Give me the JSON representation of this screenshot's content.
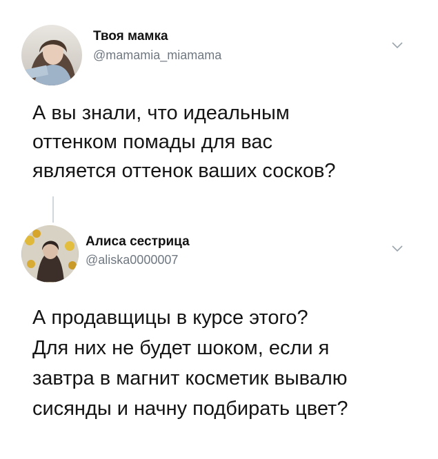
{
  "tweets": [
    {
      "author": {
        "display_name": "Твоя мамка",
        "handle": "@mamamia_miamama",
        "avatar_icon": "user-avatar-photo"
      },
      "menu_icon": "chevron-down-icon",
      "text_lines": [
        "А вы знали, что идеальным",
        "оттенком помады для вас",
        "является оттенок ваших сосков?"
      ]
    },
    {
      "author": {
        "display_name": "Алиса сестрица",
        "handle": "@aliska0000007",
        "avatar_icon": "user-avatar-photo"
      },
      "menu_icon": "chevron-down-icon",
      "text_lines": [
        "А продавщицы в курсе этого?",
        "Для них не будет шоком, если я",
        "завтра в магнит косметик вывалю",
        "сисянды и начну подбирать цвет?"
      ]
    }
  ],
  "colors": {
    "text": "#141414",
    "handle": "#6f7780",
    "thread_line": "#cfd6dc",
    "chevron": "#9aa4ad"
  }
}
